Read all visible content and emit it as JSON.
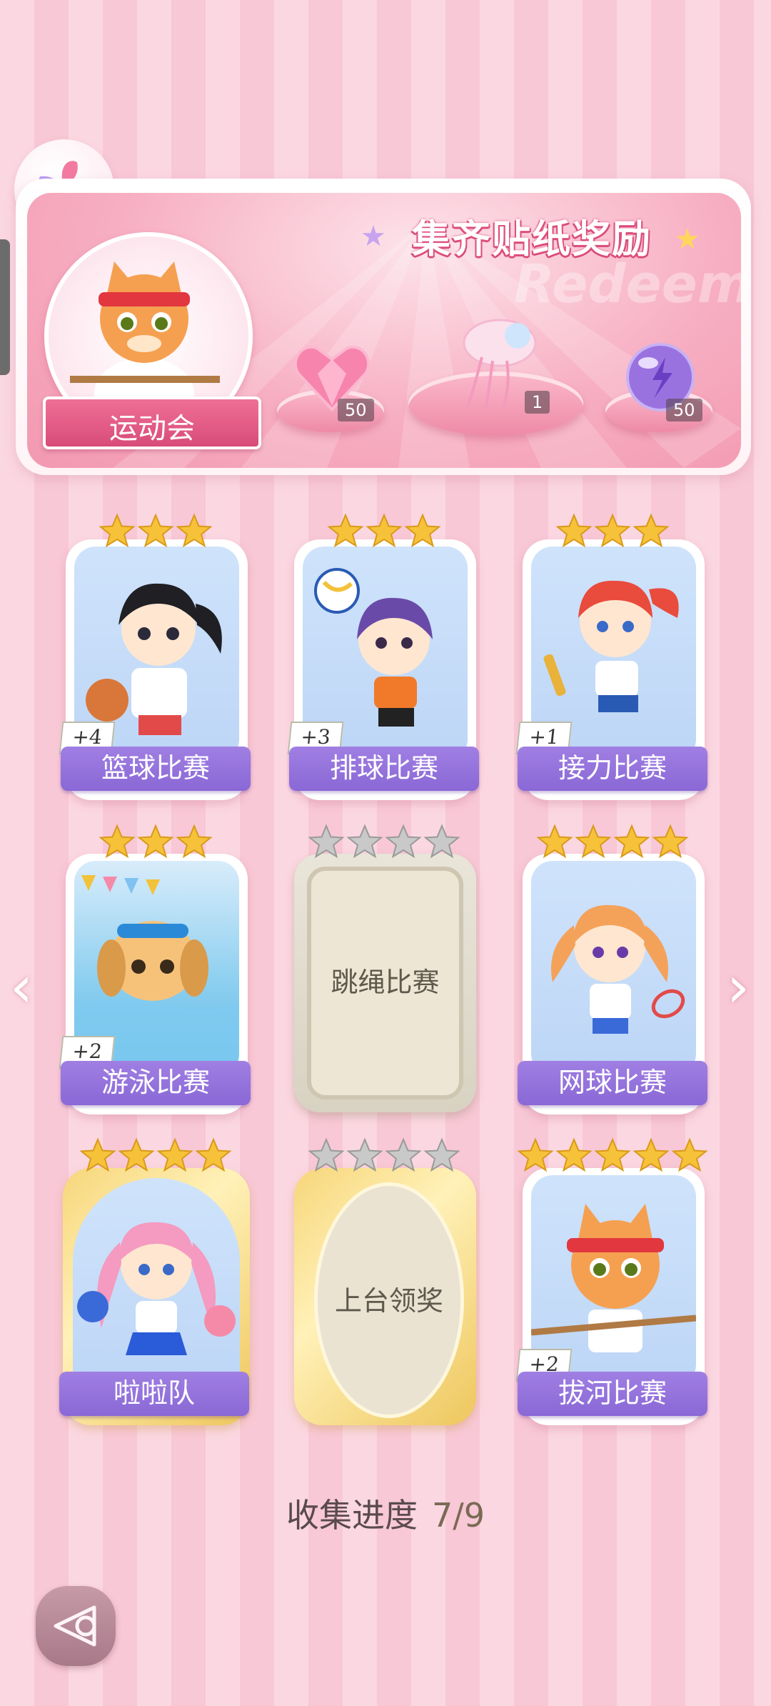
{
  "banner": {
    "title": "集齐贴纸奖励",
    "watermark": "Redeem",
    "event_name": "运动会",
    "rewards": [
      {
        "icon": "pink-heart-gem-icon",
        "quantity": "50"
      },
      {
        "icon": "jellyfish-ornament-icon",
        "quantity": "1"
      },
      {
        "icon": "purple-energy-orb-icon",
        "quantity": "50"
      }
    ]
  },
  "stickers": [
    {
      "name": "篮球比赛",
      "count": "+4",
      "stars": 3,
      "collected": true
    },
    {
      "name": "排球比赛",
      "count": "+3",
      "stars": 3,
      "collected": true
    },
    {
      "name": "接力比赛",
      "count": "+1",
      "stars": 3,
      "collected": true
    },
    {
      "name": "游泳比赛",
      "count": "+2",
      "stars": 3,
      "collected": true
    },
    {
      "name": "跳绳比赛",
      "count": "",
      "stars": 4,
      "collected": false
    },
    {
      "name": "网球比赛",
      "count": "",
      "stars": 4,
      "collected": true
    },
    {
      "name": "啦啦队",
      "count": "",
      "stars": 4,
      "collected": true
    },
    {
      "name": "上台领奖",
      "count": "",
      "stars": 4,
      "collected": false
    },
    {
      "name": "拔河比赛",
      "count": "+2",
      "stars": 5,
      "collected": true
    }
  ],
  "progress": {
    "label": "收集进度",
    "value": "7/9"
  },
  "colors": {
    "star_gold": "#f6c23a",
    "star_grey": "#c9c9c9",
    "label_purple": "#8a68d6",
    "banner_pink": "#f298b0"
  }
}
